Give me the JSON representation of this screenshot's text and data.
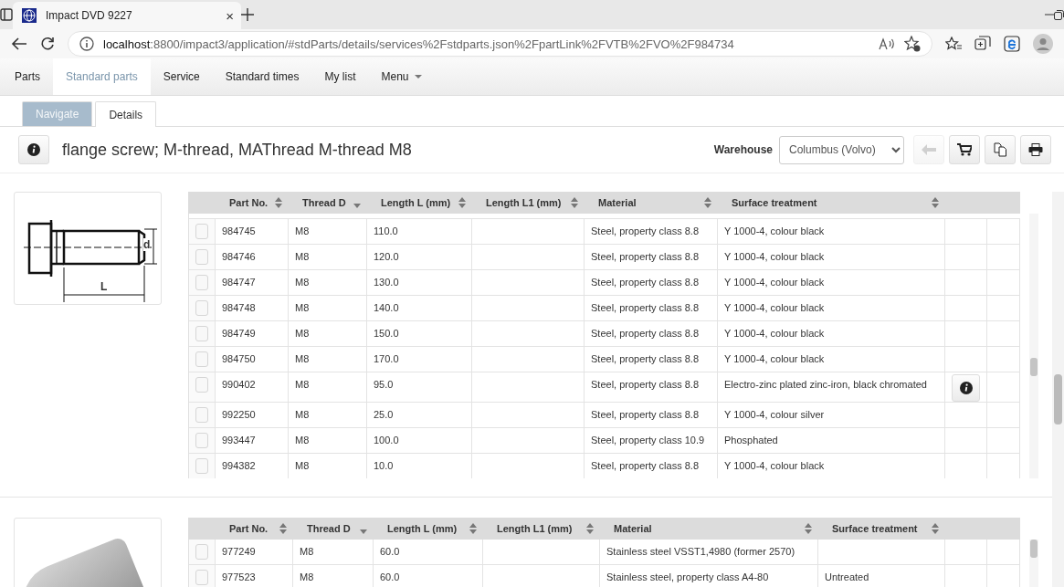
{
  "browser": {
    "tab_title": "Impact DVD 9227",
    "close_glyph": "×",
    "url_host": "localhost",
    "url_rest": ":8800/impact3/application/#stdParts/details/services%2Fstdparts.json%2FpartLink%2FVTB%2FVO%2F984734"
  },
  "nav": {
    "items": [
      {
        "label": "Parts",
        "selected": false,
        "kind": "link"
      },
      {
        "label": "Standard parts",
        "selected": true,
        "kind": "link"
      },
      {
        "label": "Service",
        "selected": false,
        "kind": "link"
      },
      {
        "label": "Standard times",
        "selected": false,
        "kind": "link"
      },
      {
        "label": "My list",
        "selected": false,
        "kind": "link"
      },
      {
        "label": "Menu",
        "selected": false,
        "kind": "dropdown"
      }
    ]
  },
  "subtabs": [
    {
      "label": "Navigate",
      "selected": false
    },
    {
      "label": "Details",
      "selected": true
    }
  ],
  "header": {
    "title": "flange screw; M-thread, MAThread M-thread M8",
    "warehouse_label": "Warehouse",
    "warehouse": "Columbus (Volvo)",
    "back_disabled": true
  },
  "groups": [
    {
      "image": {
        "kind": "drawing",
        "label_d": "d",
        "label_l": "L"
      },
      "columns": [
        {
          "label": "Part No.",
          "sorted": false
        },
        {
          "label": "Thread D",
          "sorted": true
        },
        {
          "label": "Length L (mm)",
          "sorted": false
        },
        {
          "label": "Length L1 (mm)",
          "sorted": false
        },
        {
          "label": "Material",
          "sorted": false
        },
        {
          "label": "Surface treatment",
          "sorted": false
        }
      ],
      "rows": [
        {
          "checked": false,
          "cells": [
            "984745",
            "M8",
            "110.0",
            "",
            "Steel, property class 8.8",
            "Y 1000-4, colour black"
          ],
          "info": false
        },
        {
          "checked": false,
          "cells": [
            "984746",
            "M8",
            "120.0",
            "",
            "Steel, property class 8.8",
            "Y 1000-4, colour black"
          ],
          "info": false
        },
        {
          "checked": false,
          "cells": [
            "984747",
            "M8",
            "130.0",
            "",
            "Steel, property class 8.8",
            "Y 1000-4, colour black"
          ],
          "info": false
        },
        {
          "checked": false,
          "cells": [
            "984748",
            "M8",
            "140.0",
            "",
            "Steel, property class 8.8",
            "Y 1000-4, colour black"
          ],
          "info": false
        },
        {
          "checked": false,
          "cells": [
            "984749",
            "M8",
            "150.0",
            "",
            "Steel, property class 8.8",
            "Y 1000-4, colour black"
          ],
          "info": false
        },
        {
          "checked": false,
          "cells": [
            "984750",
            "M8",
            "170.0",
            "",
            "Steel, property class 8.8",
            "Y 1000-4, colour black"
          ],
          "info": false
        },
        {
          "checked": false,
          "cells": [
            "990402",
            "M8",
            "95.0",
            "",
            "Steel, property class 8.8",
            "Electro-zinc plated zinc-iron, black chromated"
          ],
          "info": true
        },
        {
          "checked": false,
          "cells": [
            "992250",
            "M8",
            "25.0",
            "",
            "Steel, property class 8.8",
            "Y 1000-4, colour silver"
          ],
          "info": false
        },
        {
          "checked": false,
          "cells": [
            "993447",
            "M8",
            "100.0",
            "",
            "Steel, property class 10.9",
            "Phosphated"
          ],
          "info": false
        },
        {
          "checked": false,
          "cells": [
            "994382",
            "M8",
            "10.0",
            "",
            "Steel, property class 8.8",
            "Y 1000-4, colour black"
          ],
          "info": false
        }
      ]
    },
    {
      "image": {
        "kind": "photo"
      },
      "columns": [
        {
          "label": "Part No.",
          "sorted": false
        },
        {
          "label": "Thread D",
          "sorted": true
        },
        {
          "label": "Length L (mm)",
          "sorted": false
        },
        {
          "label": "Length L1 (mm)",
          "sorted": false
        },
        {
          "label": "Material",
          "sorted": false
        },
        {
          "label": "Surface treatment",
          "sorted": false
        }
      ],
      "rows": [
        {
          "checked": false,
          "cells": [
            "977249",
            "M8",
            "60.0",
            "",
            "Stainless steel VSST1,4980 (former 2570)",
            ""
          ],
          "info": false
        },
        {
          "checked": false,
          "cells": [
            "977523",
            "M8",
            "60.0",
            "",
            "Stainless steel, property class A4-80",
            "Untreated"
          ],
          "info": false
        }
      ]
    }
  ]
}
